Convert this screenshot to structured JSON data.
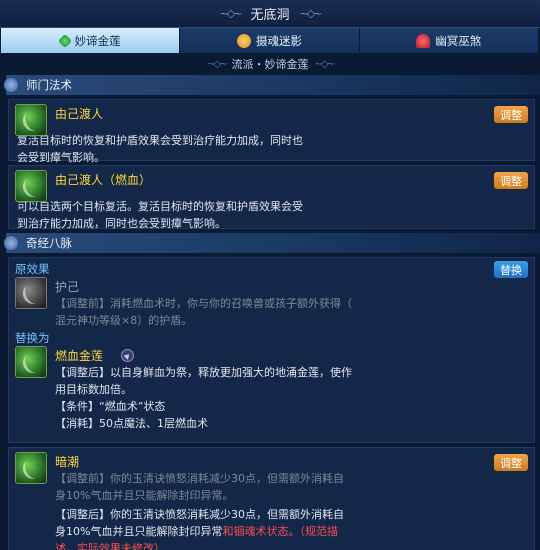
{
  "window": {
    "title": "无底洞"
  },
  "tabs": [
    {
      "label": "妙谛金莲",
      "icon": "green-gem-icon",
      "active": true
    },
    {
      "label": "摄魂迷影",
      "icon": "orange-orb-icon",
      "active": false
    },
    {
      "label": "幽冥巫煞",
      "icon": "red-bell-icon",
      "active": false
    }
  ],
  "subtitle": "流派・妙谛金莲",
  "sections": {
    "school": {
      "title": "师门法术",
      "cards": [
        {
          "name": "由己渡人",
          "button": "调整",
          "desc": [
            "复活目标时的恢复和护盾效果会受到治疗能力加成，同时也",
            "会受到瘴气影响。"
          ]
        },
        {
          "name": "由己渡人（燃血）",
          "button": "调整",
          "desc": [
            "可以自选两个目标复活。复活目标时的恢复和护盾效果会受",
            "到治疗能力加成，同时也会受到瘴气影响。"
          ]
        }
      ]
    },
    "meridian": {
      "title": "奇经八脉",
      "original_label": "原效果",
      "replace_button": "替换",
      "original": {
        "name": "护己",
        "desc": [
          "【调整前】消耗燃血术时，你与你的召唤兽或孩子额外获得（",
          "混元神功等级×8）的护盾。"
        ]
      },
      "replace_label": "替换为",
      "replacement": {
        "name": "燃血金莲",
        "desc": [
          "【调整后】以自身鲜血为祭，释放更加强大的地涌金莲，使作",
          "用目标数加倍。",
          "【条件】“燃血术”状态",
          "【消耗】50点魔法、1层燃血术"
        ]
      },
      "last": {
        "name": "暗潮",
        "button": "调整",
        "before": [
          "【调整前】你的玉清诀愤怒消耗减少30点，但需额外消耗自",
          "身10%气血并且只能解除封印异常。"
        ],
        "after_line1": "【调整后】你的玉清诀愤怒消耗减少30点，但需额外消耗自",
        "after_line2_normal": "身10%气血并且只能解除封印异常",
        "after_line2_red": "和锢魂术状态。（规范描",
        "after_line3_red": "述，实际效果未修改）"
      }
    }
  },
  "colors": {
    "accent_gold": "#ffd43b",
    "button_orange": "#e08d2c",
    "button_blue": "#2a88d6",
    "highlight_red": "#ff4d4d"
  }
}
